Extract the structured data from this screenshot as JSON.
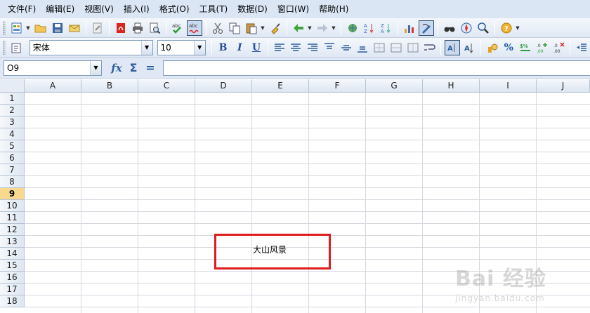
{
  "menu": [
    "文件(F)",
    "编辑(E)",
    "视图(V)",
    "插入(I)",
    "格式(O)",
    "工具(T)",
    "数据(D)",
    "窗口(W)",
    "帮助(H)"
  ],
  "toolbar": {
    "font_name": "宋体",
    "font_size": "10",
    "bold": "B",
    "italic": "I",
    "underline": "U",
    "percent": "%"
  },
  "formula_bar": {
    "name_box": "O9",
    "fx": "fx",
    "sum": "Σ",
    "equals": "=",
    "content": ""
  },
  "sheet": {
    "columns": [
      "A",
      "B",
      "C",
      "D",
      "E",
      "F",
      "G",
      "H",
      "I",
      "J"
    ],
    "rows": [
      "1",
      "2",
      "3",
      "4",
      "5",
      "6",
      "7",
      "8",
      "9",
      "10",
      "11",
      "12",
      "13",
      "14",
      "15",
      "16",
      "17",
      "18"
    ],
    "selected_row": "9",
    "cells": {
      "E7": "大山风景"
    }
  },
  "watermark": {
    "logo": "Bai 经验",
    "url": "jingyan.baidu.com"
  },
  "colors": {
    "menubar": "#dbe6f4",
    "selected_row_header": "#f8d98d",
    "annotation_box": "#e01b1b"
  }
}
